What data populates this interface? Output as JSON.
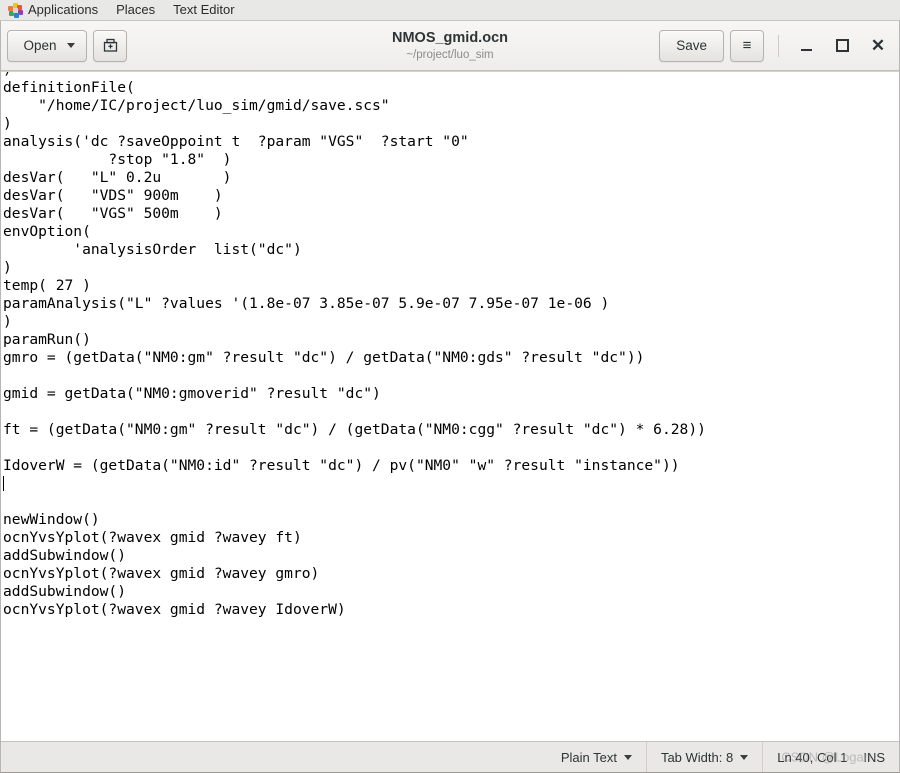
{
  "desktop_panel": {
    "apps_icon": "applications-icon",
    "items": [
      {
        "label": "Applications"
      },
      {
        "label": "Places"
      },
      {
        "label": "Text Editor"
      }
    ]
  },
  "window": {
    "title": "NMOS_gmid.ocn",
    "subtitle": "~/project/luo_sim",
    "open_label": "Open",
    "save_label": "Save",
    "save_as_icon": "save-as-icon",
    "menu_icon": "hamburger-menu-icon",
    "minimize_icon": "minimize-icon",
    "maximize_icon": "maximize-icon",
    "close_icon": "close-icon",
    "close_glyph": "✕",
    "menu_glyph": "≡"
  },
  "editor": {
    "content": ")\ndefinitionFile(\n    \"/home/IC/project/luo_sim/gmid/save.scs\"\n)\nanalysis('dc ?saveOppoint t  ?param \"VGS\"  ?start \"0\"\n            ?stop \"1.8\"  )\ndesVar(   \"L\" 0.2u       )\ndesVar(   \"VDS\" 900m    )\ndesVar(   \"VGS\" 500m    )\nenvOption(\n        'analysisOrder  list(\"dc\")\n)\ntemp( 27 )\nparamAnalysis(\"L\" ?values '(1.8e-07 3.85e-07 5.9e-07 7.95e-07 1e-06 )\n)\nparamRun()\ngmro = (getData(\"NM0:gm\" ?result \"dc\") / getData(\"NM0:gds\" ?result \"dc\"))\n\ngmid = getData(\"NM0:gmoverid\" ?result \"dc\")\n\nft = (getData(\"NM0:gm\" ?result \"dc\") / (getData(\"NM0:cgg\" ?result \"dc\") * 6.28))\n\nIdoverW = (getData(\"NM0:id\" ?result \"dc\") / pv(\"NM0\" \"w\" ?result \"instance\"))\n",
    "content_after_caret": "\n\nnewWindow()\nocnYvsYplot(?wavex gmid ?wavey ft)\naddSubwindow()\nocnYvsYplot(?wavex gmid ?wavey gmro)\naddSubwindow()\nocnYvsYplot(?wavex gmid ?wavey IdoverW)\n"
  },
  "statusbar": {
    "language": "Plain Text",
    "tab_width": "Tab Width: 8",
    "cursor_position": "Ln 40, Col 1",
    "insert_mode": "INS",
    "watermark": "CSDN @Logan"
  },
  "colors": {
    "panel_bg": "#e8e8e7",
    "headerbar_bg": "#f1efee",
    "editor_bg": "#ffffff",
    "statusbar_bg": "#e9e8e7",
    "text": "#2e3436"
  }
}
